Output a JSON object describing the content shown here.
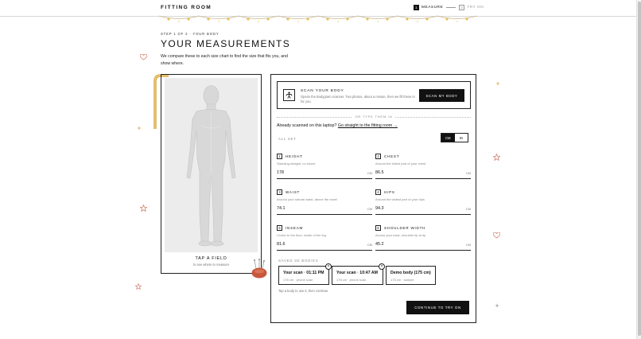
{
  "header": {
    "logo": "FITTING ROOM",
    "steps": [
      {
        "num": "1",
        "label": "MEASURE"
      },
      {
        "num": "2",
        "label": "TRY ON"
      }
    ]
  },
  "intro": {
    "eyebrow": "STEP 1 OF 2 · YOUR BODY",
    "title": "YOUR MEASUREMENTS",
    "subtitle": "We compare these to each size chart to find the size that fits you, and show where."
  },
  "figure": {
    "tap_title": "TAP A FIELD",
    "tap_subtitle": "to see where to measure"
  },
  "scan": {
    "title": "SCAN YOUR BODY",
    "description": "Opens the Bodygram scanner. Two photos, about a minute, then we fill these in for you.",
    "button": "SCAN MY BODY",
    "icon": "scan-body-icon"
  },
  "or_text": "OR TYPE THEM IN",
  "already": {
    "prefix": "Already scanned on this laptop?",
    "link": "Go straight to the fitting room →"
  },
  "status": "ALL SET",
  "units": {
    "options": [
      "CM",
      "IN"
    ],
    "selected": "CM"
  },
  "fields": [
    {
      "num": "1",
      "label": "HEIGHT",
      "hint": "Standing straight, no shoes",
      "value": "178",
      "unit": "CM"
    },
    {
      "num": "2",
      "label": "CHEST",
      "hint": "Around the fullest part of your chest",
      "value": "86.5",
      "unit": "CM"
    },
    {
      "num": "3",
      "label": "WAIST",
      "hint": "Around your natural waist, above the navel",
      "value": "74.1",
      "unit": "CM"
    },
    {
      "num": "4",
      "label": "HIPS",
      "hint": "Around the widest part of your hips",
      "value": "94.3",
      "unit": "CM"
    },
    {
      "num": "5",
      "label": "INSEAM",
      "hint": "Crotch to the floor, inside of the leg",
      "value": "81.6",
      "unit": "CM"
    },
    {
      "num": "6",
      "label": "SHOULDER WIDTH",
      "hint": "Across your back, shoulder tip to tip",
      "value": "45.2",
      "unit": "CM"
    }
  ],
  "saved": {
    "title": "SAVED 3D BODIES",
    "cards": [
      {
        "name": "Your scan · 01:11 PM",
        "meta": "178 cm · phone scan",
        "close": "×"
      },
      {
        "name": "Your scan · 10:47 AM",
        "meta": "178 cm · phone scan",
        "close": "×"
      },
      {
        "name": "Demo body (175 cm)",
        "meta": "175 cm · sample"
      }
    ],
    "hint": "Tap a body to use it, then continue"
  },
  "continue_button": "CONTINUE TO TRY ON",
  "colors": {
    "ink": "#111111",
    "accent_warm": "#c8583c",
    "gold": "#d9a94a",
    "panel_bg": "#ececec"
  }
}
